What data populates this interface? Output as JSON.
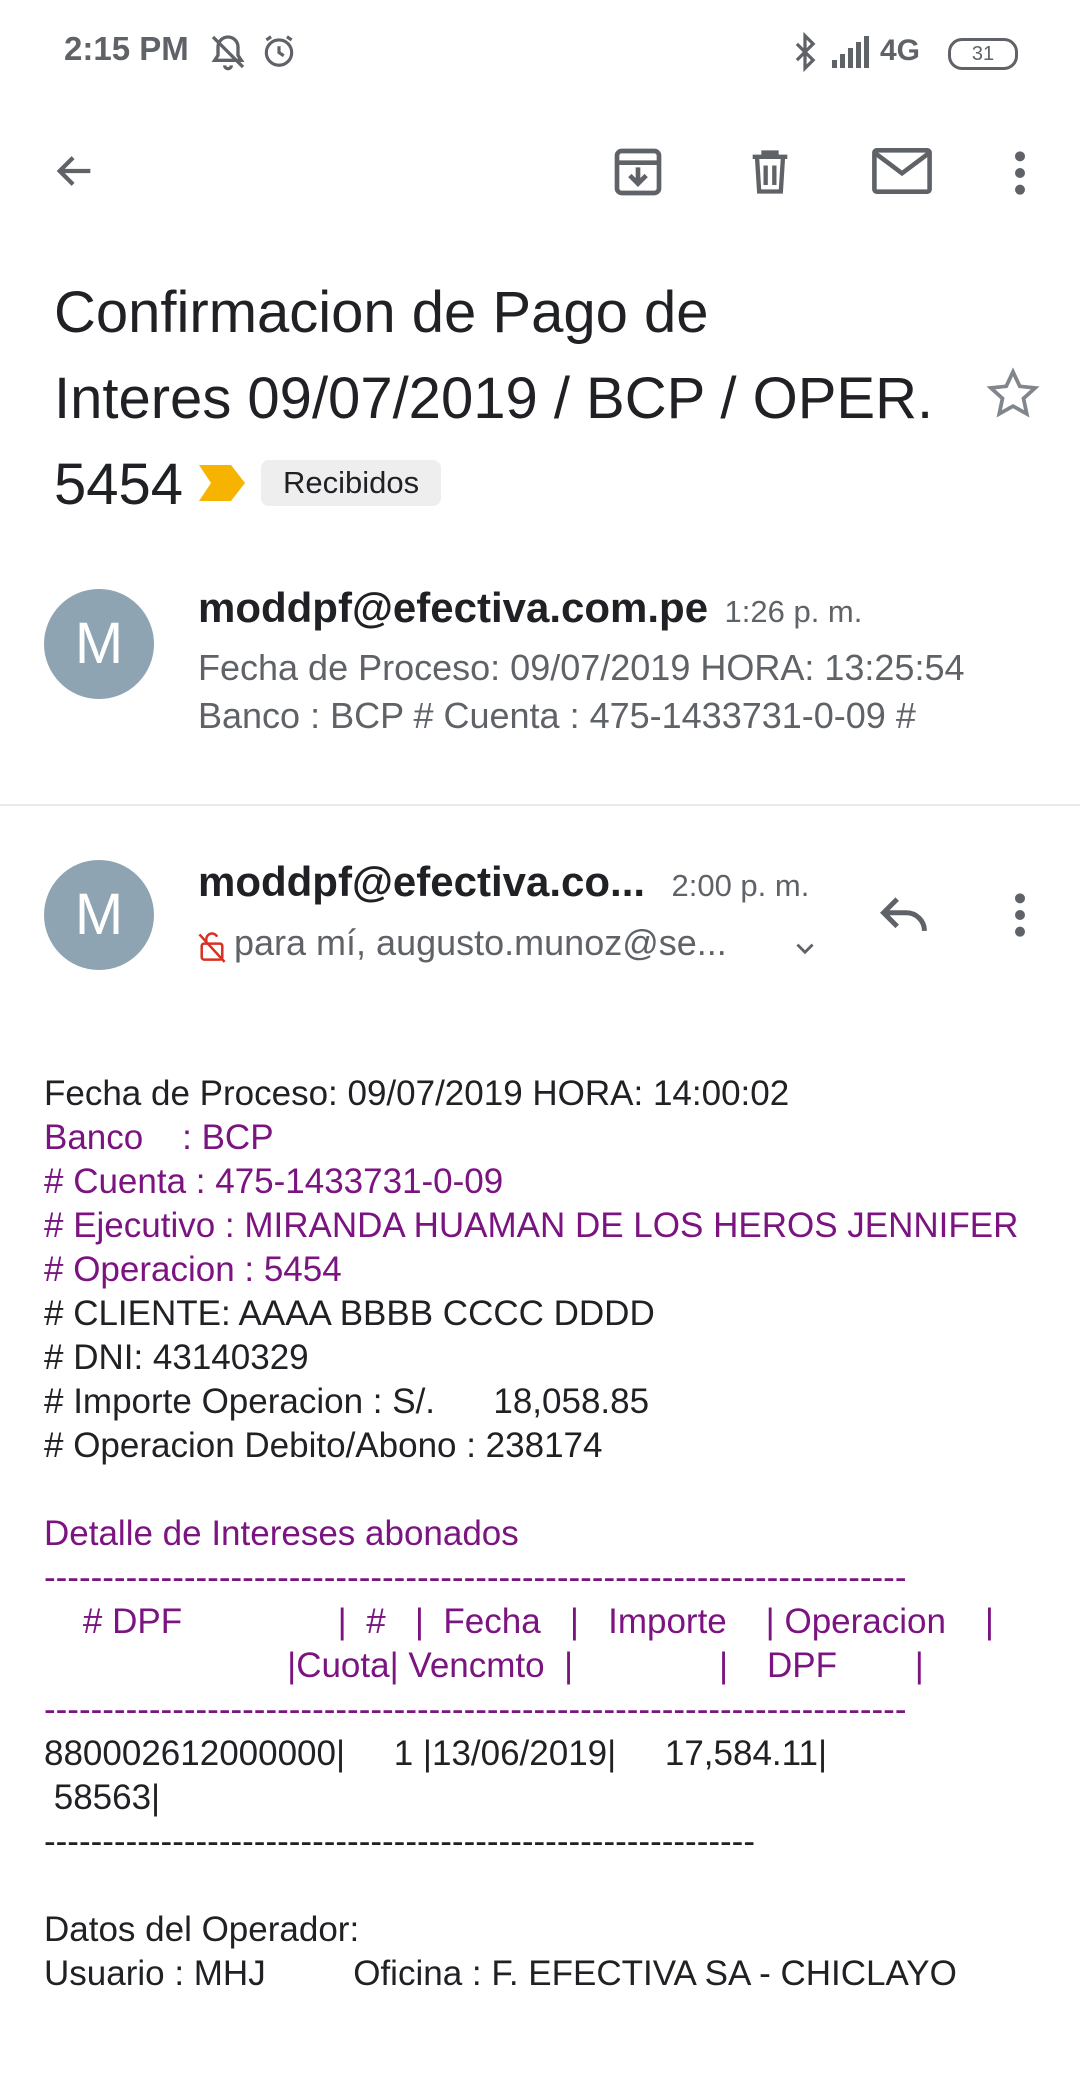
{
  "status_bar": {
    "time": "2:15 PM",
    "network": "4G",
    "battery": "31"
  },
  "toolbar": {
    "back_icon": "arrow-left-icon",
    "archive_icon": "archive-icon",
    "delete_icon": "trash-icon",
    "mark_unread_icon": "mail-icon",
    "more_icon": "more-vert-icon"
  },
  "subject": {
    "line1": "Confirmacion de Pago de",
    "line2": "Interes 09/07/2019 / BCP / OPER.",
    "line3": "5454",
    "label": "Recibidos",
    "importance_color": "#f6b400"
  },
  "message1": {
    "avatar_letter": "M",
    "sender": "moddpf@efectiva.com.pe",
    "time": "1:26 p. m.",
    "snippet_line1": "Fecha de Proceso: 09/07/2019 HORA: 13:25:54",
    "snippet_line2": "Banco : BCP # Cuenta : 475-1433731-0-09 #"
  },
  "message2": {
    "avatar_letter": "M",
    "sender": "moddpf@efectiva.co...",
    "time": "2:00 p. m.",
    "recipients": "para mí, augusto.munoz@se...",
    "body": [
      {
        "text": "Fecha de Proceso: 09/07/2019 HORA: 14:00:02",
        "color": "dark"
      },
      {
        "text": "Banco    : BCP",
        "color": "purple"
      },
      {
        "text": "# Cuenta : 475-1433731-0-09",
        "color": "purple"
      },
      {
        "text": "# Ejecutivo : MIRANDA HUAMAN DE LOS HEROS JENNIFER",
        "color": "purple"
      },
      {
        "text": "# Operacion : 5454",
        "color": "purple"
      },
      {
        "text": "# CLIENTE: AAAA BBBB CCCC DDDD",
        "color": "dark"
      },
      {
        "text": "# DNI: 43140329",
        "color": "dark"
      },
      {
        "text": "# Importe Operacion : S/.      18,058.85",
        "color": "dark"
      },
      {
        "text": "# Operacion Debito/Abono : 238174",
        "color": "dark"
      },
      {
        "text": "",
        "color": "dark"
      },
      {
        "text": "Detalle de Intereses abonados",
        "color": "purple"
      },
      {
        "text": "--------------------------------------------------------------------------",
        "color": "purple"
      },
      {
        "text": "    # DPF                |  #   |  Fecha   |   Importe    | Operacion    |",
        "color": "purple"
      },
      {
        "text": "                         |Cuota| Vencmto  |               |    DPF        |",
        "color": "purple"
      },
      {
        "text": "--------------------------------------------------------------------------",
        "color": "purple"
      },
      {
        "text": "880002612000000|     1 |13/06/2019|     17,584.11|",
        "color": "dark"
      },
      {
        "text": " 58563|",
        "color": "dark"
      },
      {
        "text": "-------------------------------------------------------------",
        "color": "dark"
      },
      {
        "text": "",
        "color": "dark"
      },
      {
        "text": "Datos del Operador:",
        "color": "dark"
      },
      {
        "text": "Usuario : MHJ         Oficina : F. EFECTIVA SA - CHICLAYO",
        "color": "dark"
      }
    ]
  }
}
